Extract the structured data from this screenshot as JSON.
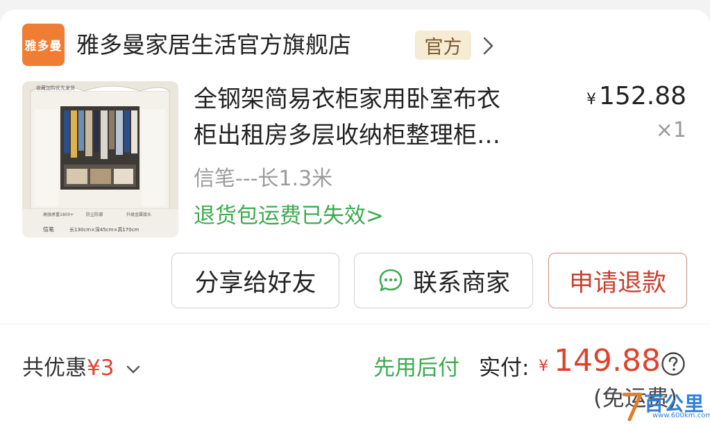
{
  "store": {
    "logo_text": "雅多曼",
    "name": "雅多曼家居生活官方旗舰店",
    "badge": "官方",
    "chevron_icon": "chevron-right-icon"
  },
  "product": {
    "title_line1": "全钢架简易衣柜家用卧室布衣",
    "title_line2": "柜出租房多层收纳柜整理柜…",
    "price_symbol": "¥",
    "price": "152.88",
    "quantity": "×1",
    "spec": "信笔---长1.3米",
    "return_note": "退货包运费已失效",
    "return_chevron": ">",
    "thumbnail_icon": "wardrobe-product-image",
    "thumbnail_texts": {
      "top_banner": "收藏加购优先发货",
      "feature1": "高强承重1800+",
      "feature2": "防尘防潮",
      "feature3": "升级金属接头",
      "brand": "信笔",
      "size": "长130cm×深45cm×高170cm"
    }
  },
  "actions": {
    "share": "分享给好友",
    "contact": "联系商家",
    "contact_icon": "chat-bubble-icon",
    "refund": "申请退款"
  },
  "summary": {
    "discount_label": "共优惠",
    "discount_amount": "¥3",
    "pay_method": "先用后付",
    "paid_label": "实付:",
    "paid_symbol": "¥",
    "paid_amount": "149.88",
    "help_icon": "question-circle-icon",
    "shipping_note": "(免运费)"
  },
  "watermark": {
    "text": "百公里",
    "url": "www.600km.com"
  },
  "colors": {
    "accent_red": "#e0412e",
    "green": "#3cab4e",
    "logo_orange": "#f07d34",
    "badge_bg": "#f6ebd3"
  }
}
